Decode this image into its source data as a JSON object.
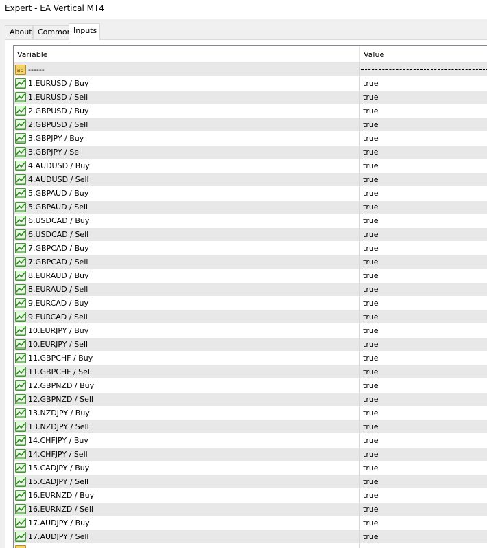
{
  "window": {
    "title": "Expert - EA Vertical MT4"
  },
  "tabs": [
    {
      "label": "About",
      "active": false
    },
    {
      "label": "Common",
      "active": false
    },
    {
      "label": "Inputs",
      "active": true
    }
  ],
  "grid": {
    "headers": {
      "variable": "Variable",
      "value": "Value"
    },
    "rows": [
      {
        "variable": "------",
        "value": "",
        "icon": "string-ab-icon"
      },
      {
        "variable": "1.EURUSD / Buy",
        "value": "true",
        "icon": "bool-chart-icon"
      },
      {
        "variable": "1.EURUSD / Sell",
        "value": "true",
        "icon": "bool-chart-icon"
      },
      {
        "variable": "2.GBPUSD / Buy",
        "value": "true",
        "icon": "bool-chart-icon"
      },
      {
        "variable": "2.GBPUSD / Sell",
        "value": "true",
        "icon": "bool-chart-icon"
      },
      {
        "variable": "3.GBPJPY / Buy",
        "value": "true",
        "icon": "bool-chart-icon"
      },
      {
        "variable": "3.GBPJPY / Sell",
        "value": "true",
        "icon": "bool-chart-icon"
      },
      {
        "variable": "4.AUDUSD / Buy",
        "value": "true",
        "icon": "bool-chart-icon"
      },
      {
        "variable": "4.AUDUSD / Sell",
        "value": "true",
        "icon": "bool-chart-icon"
      },
      {
        "variable": "5.GBPAUD / Buy",
        "value": "true",
        "icon": "bool-chart-icon"
      },
      {
        "variable": "5.GBPAUD / Sell",
        "value": "true",
        "icon": "bool-chart-icon"
      },
      {
        "variable": "6.USDCAD / Buy",
        "value": "true",
        "icon": "bool-chart-icon"
      },
      {
        "variable": "6.USDCAD / Sell",
        "value": "true",
        "icon": "bool-chart-icon"
      },
      {
        "variable": "7.GBPCAD / Buy",
        "value": "true",
        "icon": "bool-chart-icon"
      },
      {
        "variable": "7.GBPCAD / Sell",
        "value": "true",
        "icon": "bool-chart-icon"
      },
      {
        "variable": "8.EURAUD / Buy",
        "value": "true",
        "icon": "bool-chart-icon"
      },
      {
        "variable": "8.EURAUD / Sell",
        "value": "true",
        "icon": "bool-chart-icon"
      },
      {
        "variable": "9.EURCAD / Buy",
        "value": "true",
        "icon": "bool-chart-icon"
      },
      {
        "variable": "9.EURCAD / Sell",
        "value": "true",
        "icon": "bool-chart-icon"
      },
      {
        "variable": "10.EURJPY / Buy",
        "value": "true",
        "icon": "bool-chart-icon"
      },
      {
        "variable": "10.EURJPY / Sell",
        "value": "true",
        "icon": "bool-chart-icon"
      },
      {
        "variable": "11.GBPCHF / Buy",
        "value": "true",
        "icon": "bool-chart-icon"
      },
      {
        "variable": "11.GBPCHF / Sell",
        "value": "true",
        "icon": "bool-chart-icon"
      },
      {
        "variable": "12.GBPNZD / Buy",
        "value": "true",
        "icon": "bool-chart-icon"
      },
      {
        "variable": "12.GBPNZD / Sell",
        "value": "true",
        "icon": "bool-chart-icon"
      },
      {
        "variable": "13.NZDJPY / Buy",
        "value": "true",
        "icon": "bool-chart-icon"
      },
      {
        "variable": "13.NZDJPY / Sell",
        "value": "true",
        "icon": "bool-chart-icon"
      },
      {
        "variable": "14.CHFJPY / Buy",
        "value": "true",
        "icon": "bool-chart-icon"
      },
      {
        "variable": "14.CHFJPY / Sell",
        "value": "true",
        "icon": "bool-chart-icon"
      },
      {
        "variable": "15.CADJPY / Buy",
        "value": "true",
        "icon": "bool-chart-icon"
      },
      {
        "variable": "15.CADJPY / Sell",
        "value": "true",
        "icon": "bool-chart-icon"
      },
      {
        "variable": "16.EURNZD / Buy",
        "value": "true",
        "icon": "bool-chart-icon"
      },
      {
        "variable": "16.EURNZD / Sell",
        "value": "true",
        "icon": "bool-chart-icon"
      },
      {
        "variable": "17.AUDJPY / Buy",
        "value": "true",
        "icon": "bool-chart-icon"
      },
      {
        "variable": "17.AUDJPY / Sell",
        "value": "true",
        "icon": "bool-chart-icon"
      },
      {
        "variable": "",
        "value": "",
        "icon": "string-ab-icon"
      }
    ]
  }
}
